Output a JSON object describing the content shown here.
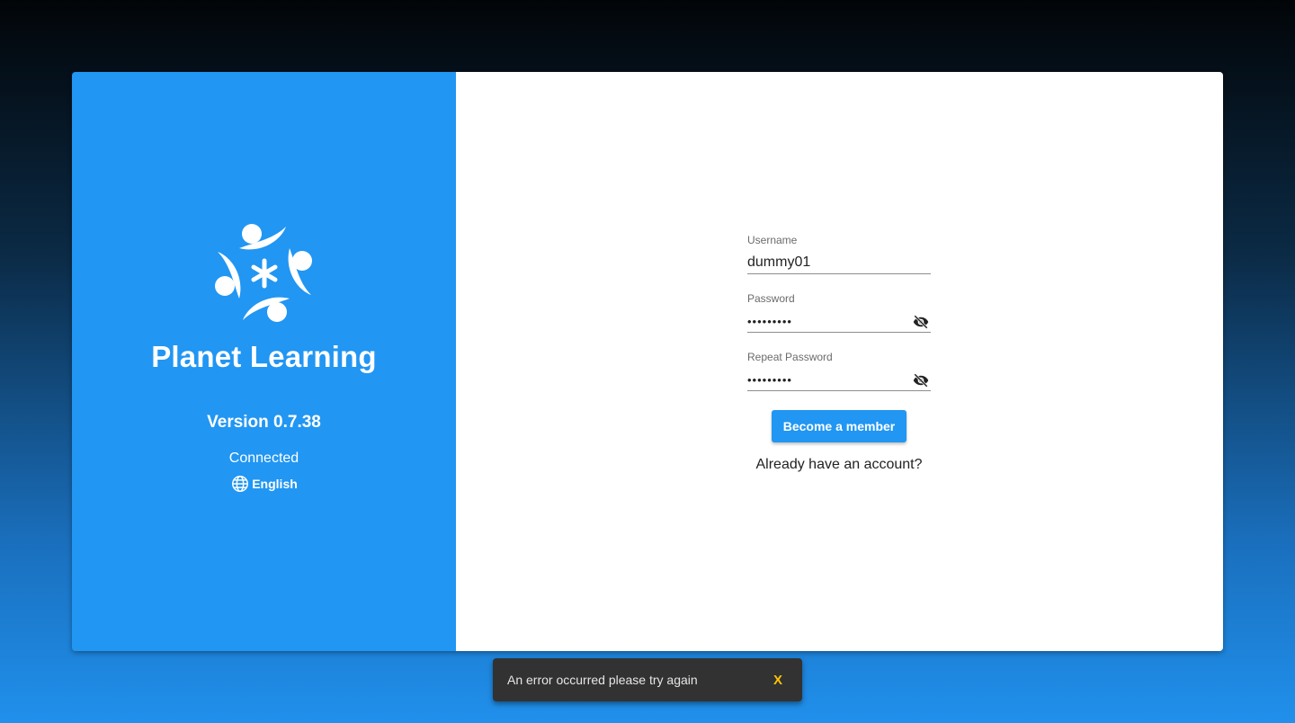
{
  "branding": {
    "app_name": "Planet Learning",
    "version": "Version 0.7.38",
    "status": "Connected",
    "language": "English",
    "logo_icon": "planet-learning-logo"
  },
  "form": {
    "username": {
      "label": "Username",
      "value": "dummy01"
    },
    "password": {
      "label": "Password",
      "value": "•••••••••"
    },
    "repeat_password": {
      "label": "Repeat Password",
      "value": "•••••••••"
    },
    "toggle_icon": "eye-off-icon",
    "submit_label": "Become a member",
    "login_link": "Already have an account?"
  },
  "snackbar": {
    "message": "An error occurred please try again",
    "close_label": "X"
  },
  "colors": {
    "primary": "#2196f3",
    "snackbar_bg": "#323232",
    "snackbar_action": "#ffc107"
  }
}
